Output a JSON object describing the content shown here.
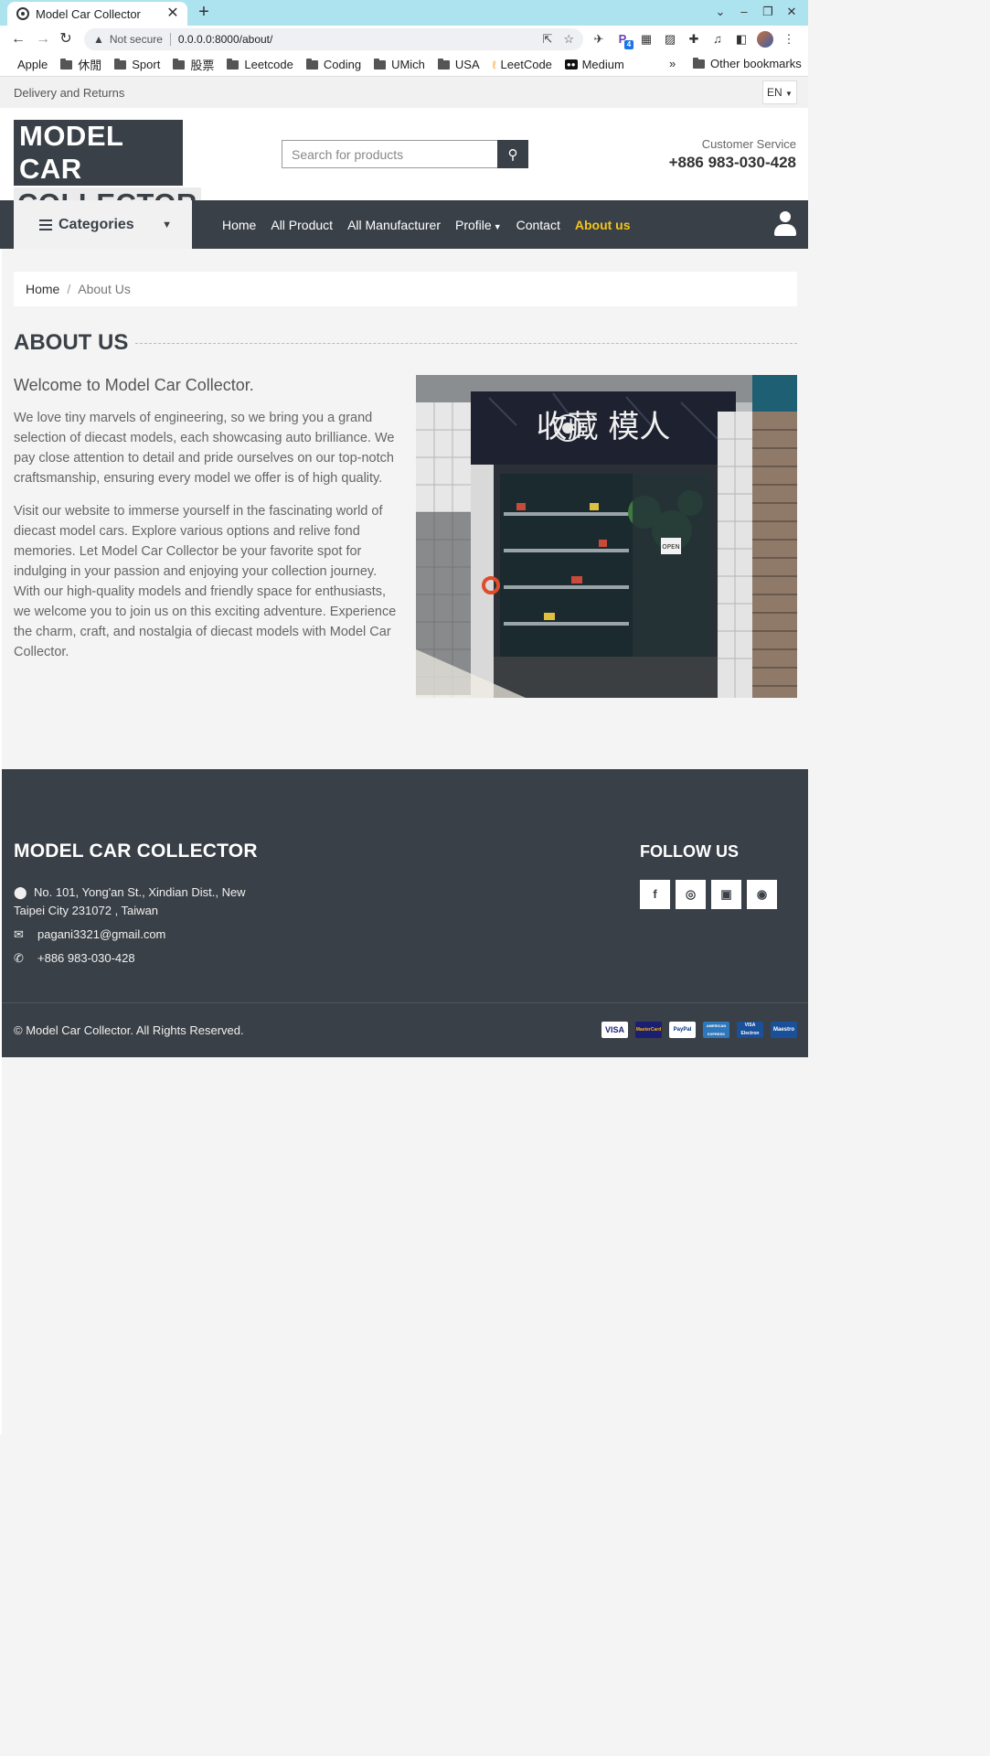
{
  "browser": {
    "tab_title": "Model Car Collector",
    "url_security": "Not secure",
    "url": "0.0.0.0:8000/about/",
    "bookmarks": [
      {
        "label": "Apple",
        "icon": "apple-icon"
      },
      {
        "label": "休閒",
        "icon": "folder-icon"
      },
      {
        "label": "Sport",
        "icon": "folder-icon"
      },
      {
        "label": "股票",
        "icon": "folder-icon"
      },
      {
        "label": "Leetcode",
        "icon": "folder-icon"
      },
      {
        "label": "Coding",
        "icon": "folder-icon"
      },
      {
        "label": "UMich",
        "icon": "folder-icon"
      },
      {
        "label": "USA",
        "icon": "folder-icon"
      },
      {
        "label": "LeetCode",
        "icon": "leetcode-icon"
      },
      {
        "label": "Medium",
        "icon": "medium-icon"
      }
    ],
    "other_bookmarks": "Other bookmarks",
    "extension_badge": "4"
  },
  "topbar": {
    "delivery": "Delivery and Returns",
    "lang": "EN"
  },
  "header": {
    "logo_line1": "MODEL CAR",
    "logo_line2": "COLLECTOR",
    "search_placeholder": "Search for products",
    "cs_label": "Customer Service",
    "cs_phone": "+886 983-030-428"
  },
  "nav": {
    "categories": "Categories",
    "items": [
      "Home",
      "All Product",
      "All Manufacturer",
      "Profile",
      "Contact",
      "About us"
    ],
    "active": "About us"
  },
  "breadcrumb": {
    "home": "Home",
    "current": "About Us"
  },
  "about": {
    "title": "ABOUT US",
    "welcome": "Welcome to Model Car Collector.",
    "para1": "We love tiny marvels of engineering, so we bring you a grand selection of diecast models, each showcasing auto brilliance. We pay close attention to detail and pride ourselves on our top-notch craftsmanship, ensuring every model we offer is of high quality.",
    "para2": "Visit our website to immerse yourself in the fascinating world of diecast model cars. Explore various options and relive fond memories. Let Model Car Collector be your favorite spot for indulging in your passion and enjoying your collection journey. With our high-quality models and friendly space for enthusiasts, we welcome you to join us on this exciting adventure. Experience the charm, craft, and nostalgia of diecast models with Model Car Collector.",
    "sign_text": "收藏 模人",
    "open_sign": "OPEN"
  },
  "footer": {
    "brand": "MODEL CAR COLLECTOR",
    "address": "No. 101, Yong'an St., Xindian Dist., New Taipei City 231072 , Taiwan",
    "email": "pagani3321@gmail.com",
    "phone": "+886 983-030-428",
    "follow": "FOLLOW US",
    "copyright": "© Model Car Collector. All Rights Reserved.",
    "payment_cards": [
      "VISA",
      "MasterCard",
      "PayPal",
      "AMERICAN EXPRESS",
      "VISA Electron",
      "Maestro"
    ]
  },
  "colors": {
    "dark": "#3a4047",
    "accent": "#f5c518",
    "tabbar": "#ade2ef"
  }
}
